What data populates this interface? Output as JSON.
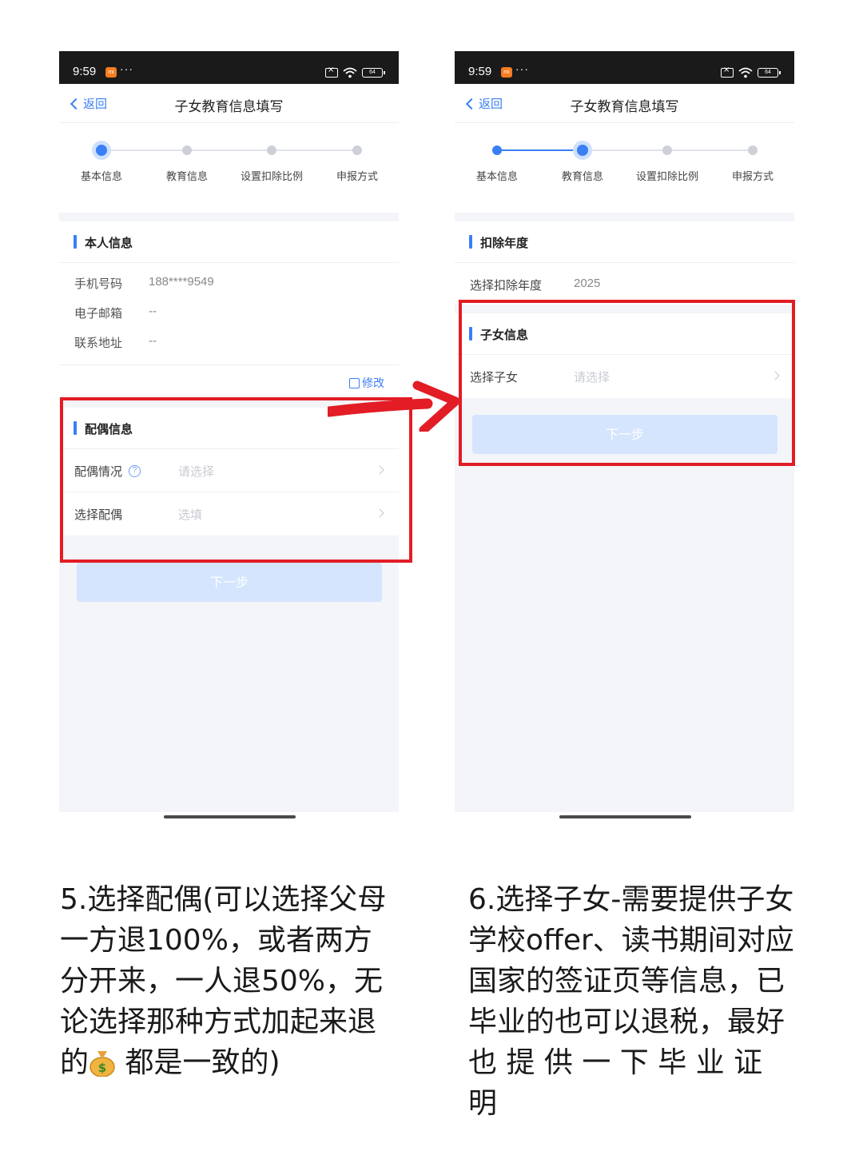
{
  "status_bar": {
    "time": "9:59",
    "dots": "···",
    "battery": "64"
  },
  "left_phone": {
    "back_label": "返回",
    "title": "子女教育信息填写",
    "steps": [
      "基本信息",
      "教育信息",
      "设置扣除比例",
      "申报方式"
    ],
    "current_step": 1,
    "personal": {
      "title": "本人信息",
      "rows": [
        {
          "label": "手机号码",
          "value": "188****9549"
        },
        {
          "label": "电子邮箱",
          "value": "--"
        },
        {
          "label": "联系地址",
          "value": "--"
        }
      ],
      "edit_label": "修改"
    },
    "spouse": {
      "title": "配偶信息",
      "rows": [
        {
          "label": "配偶情况",
          "placeholder": "请选择",
          "has_help": true
        },
        {
          "label": "选择配偶",
          "placeholder": "选填"
        }
      ]
    },
    "next_label": "下一步"
  },
  "right_phone": {
    "back_label": "返回",
    "title": "子女教育信息填写",
    "steps": [
      "基本信息",
      "教育信息",
      "设置扣除比例",
      "申报方式"
    ],
    "current_step": 2,
    "deduction": {
      "title": "扣除年度",
      "row_label": "选择扣除年度",
      "row_value": "2025"
    },
    "child": {
      "title": "子女信息",
      "row_label": "选择子女",
      "row_placeholder": "请选择"
    },
    "next_label": "下一步"
  },
  "captions": {
    "left_lines": [
      "5.选择配偶(可以选择父母",
      "一方退100%，或者两方",
      "分开来，一人退50%，无",
      "论选择那种方式加起来退"
    ],
    "left_last_before": "的",
    "left_last_after": "都是一致的)",
    "right_lines": [
      "6.选择子女-需要提供子女",
      "学校offer、读书期间对应",
      "国家的签证页等信息，已",
      "毕业的也可以退税，最好",
      "也 提 供 一 下 毕 业 证 明"
    ]
  },
  "colors": {
    "accent": "#3a7ff5",
    "highlight": "#e21d25",
    "button_disabled": "#d4e5fd"
  }
}
